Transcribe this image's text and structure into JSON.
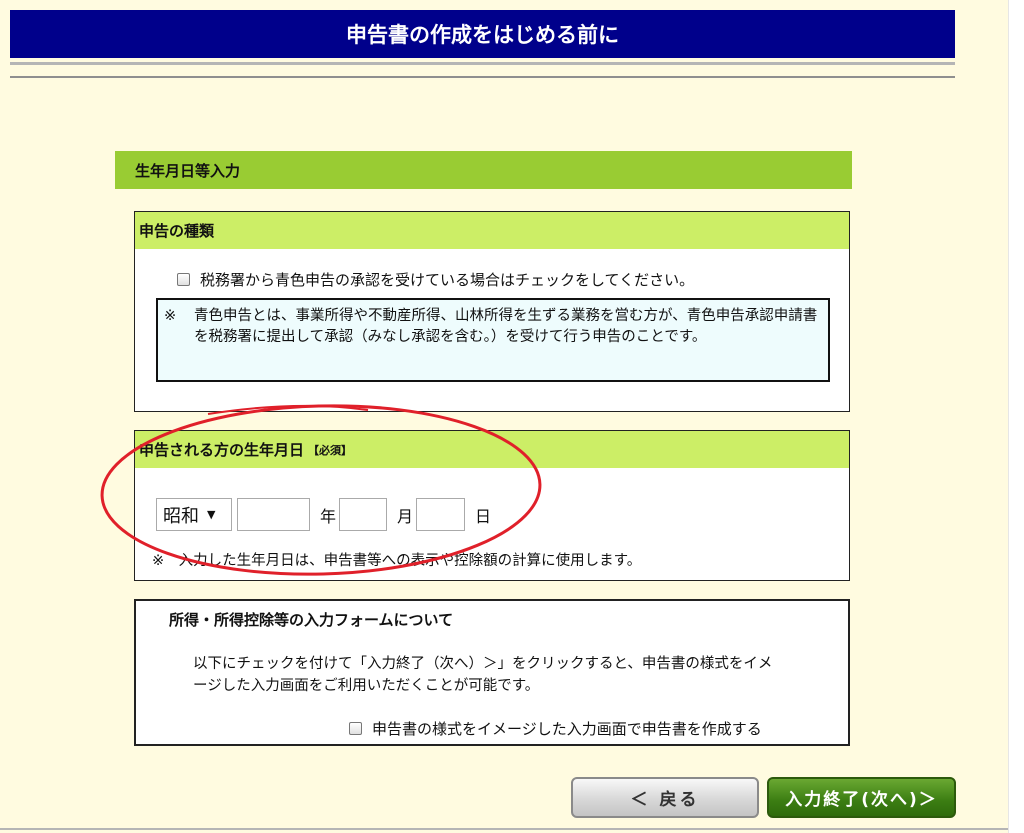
{
  "header": {
    "title": "申告書の作成をはじめる前に"
  },
  "section": {
    "title": "生年月日等入力"
  },
  "declaration_type": {
    "heading": "申告の種類",
    "blue_checkbox_label": "税務署から青色申告の承認を受けている場合はチェックをしてください。",
    "note_mark": "※",
    "note_text": "青色申告とは、事業所得や不動産所得、山林所得を生ずる業務を営む方が、青色申告承認申請書を税務署に提出して承認（みなし承認を含む。）を受けて行う申告のことです。"
  },
  "birthdate": {
    "heading": "申告される方の生年月日",
    "required_badge": "【必須】",
    "era_selected": "昭和",
    "year_value": "",
    "year_unit": "年",
    "month_value": "",
    "month_unit": "月",
    "day_value": "",
    "day_unit": "日",
    "note": "※　入力した生年月日は、申告書等への表示や控除額の計算に使用します。"
  },
  "input_form": {
    "title": "所得・所得控除等の入力フォームについて",
    "description": "以下にチェックを付けて「入力終了（次へ）＞」をクリックすると、申告書の様式をイメージした入力画面をご利用いただくことが可能です。",
    "checkbox_label": "申告書の様式をイメージした入力画面で申告書を作成する"
  },
  "buttons": {
    "back_label": "＜ 戻る",
    "next_label": "入力終了(次へ)＞"
  },
  "colors": {
    "header": "#00008b",
    "section_bar": "#99cc33",
    "panel_head": "#ccee66",
    "annotation": "#e0202a",
    "next_button": "#3b7d12"
  }
}
